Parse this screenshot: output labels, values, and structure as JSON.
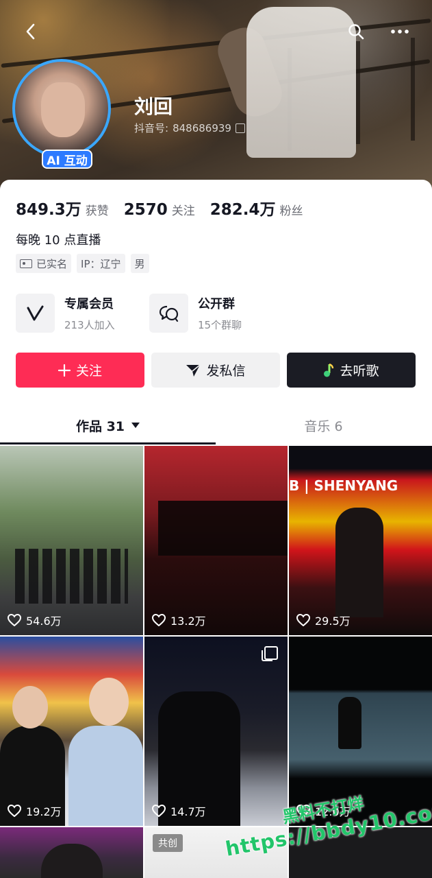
{
  "profile": {
    "name": "刘回",
    "douyin_id_label": "抖音号:",
    "douyin_id": "848686939",
    "ai_badge": "AI 互动",
    "stats": [
      {
        "value": "849.3万",
        "label": "获赞"
      },
      {
        "value": "2570",
        "label": "关注"
      },
      {
        "value": "282.4万",
        "label": "粉丝"
      }
    ],
    "bio": "每晚 10 点直播",
    "tags": [
      "已实名",
      "IP：辽宁",
      "男"
    ]
  },
  "features": [
    {
      "title": "专属会员",
      "subtitle": "213人加入",
      "icon": "v-logo-icon"
    },
    {
      "title": "公开群",
      "subtitle": "15个群聊",
      "icon": "chat-bubbles-icon"
    }
  ],
  "actions": {
    "follow": "关注",
    "message": "发私信",
    "music": "去听歌"
  },
  "tabs": [
    {
      "label": "作品 31"
    },
    {
      "label": "音乐 6"
    }
  ],
  "videos": [
    {
      "likes": "54.6万"
    },
    {
      "likes": "13.2万"
    },
    {
      "likes": "29.5万"
    },
    {
      "likes": "19.2万"
    },
    {
      "likes": "14.7万"
    },
    {
      "likes": "12.0万"
    }
  ],
  "video_texts": {
    "banner_text": "B | SHENYANG",
    "cocreate": "共创"
  },
  "watermark": {
    "line1": "黑料不打烊",
    "line2": "https://bbdy10.com"
  },
  "colors": {
    "follow": "#fe2c55",
    "music_button": "#1b1c24",
    "avatar_ring": "#3aa7ff",
    "ai_badge": "#2d7bff",
    "watermark": "#22c56a"
  }
}
